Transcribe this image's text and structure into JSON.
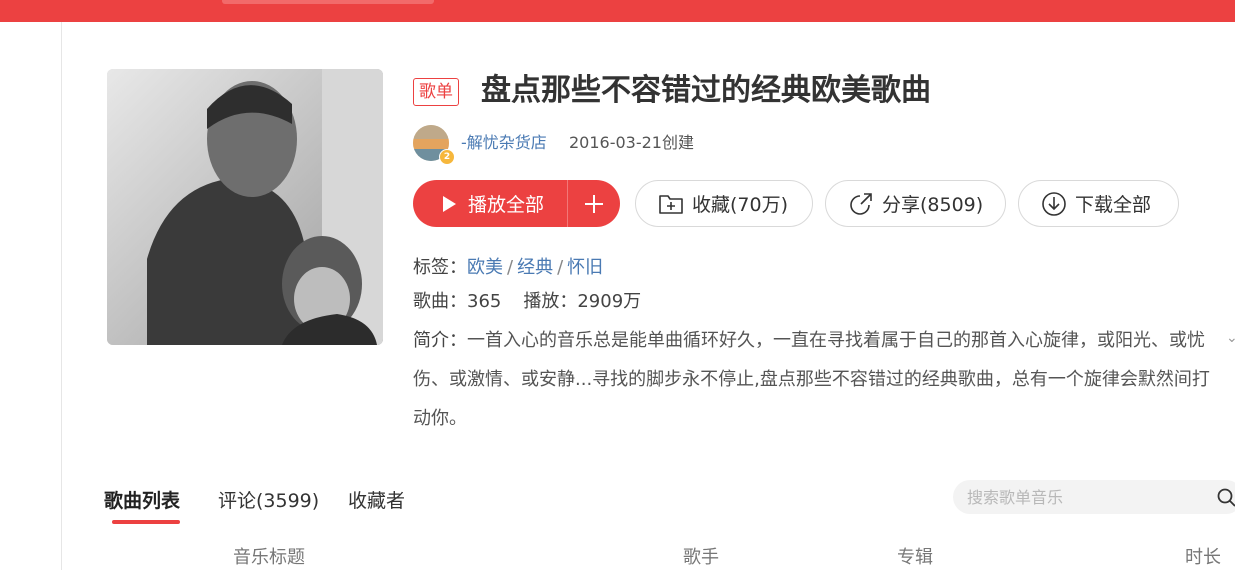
{
  "header": {
    "accent": "#ec4141"
  },
  "playlist": {
    "badge": "歌单",
    "title": "盘点那些不容错过的经典欧美歌曲",
    "creator": "-解忧杂货店",
    "created": "2016-03-21创建",
    "cover_icon": "playlist-cover-photo"
  },
  "actions": {
    "play_all": "播放全部",
    "favorite": "收藏(70万)",
    "share": "分享(8509)",
    "download_all": "下载全部"
  },
  "info": {
    "tags_label": "标签：",
    "tags": [
      "欧美",
      "经典",
      "怀旧"
    ],
    "tag_sep": "/",
    "songs_label": "歌曲：",
    "songs_count": "365",
    "plays_label": "播放：",
    "plays_count": "2909万",
    "desc_label": "简介：",
    "description": "一首入心的音乐总是能单曲循环好久，一直在寻找着属于自己的那首入心旋律，或阳光、或忧伤、或激情、或安静...寻找的脚步永不停止,盘点那些不容错过的经典歌曲，总有一个旋律会默然间打动你。"
  },
  "tabs": [
    {
      "label": "歌曲列表",
      "active": true
    },
    {
      "label": "评论(3599)",
      "active": false
    },
    {
      "label": "收藏者",
      "active": false
    }
  ],
  "search": {
    "placeholder": "搜索歌单音乐"
  },
  "table": {
    "columns": [
      "音乐标题",
      "歌手",
      "专辑",
      "时长"
    ]
  }
}
